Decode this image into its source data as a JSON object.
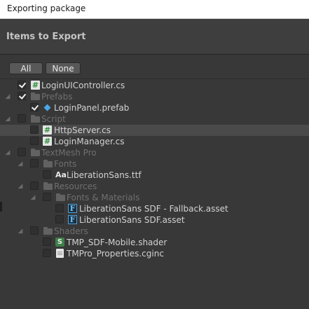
{
  "window": {
    "title": "Exporting package"
  },
  "header": {
    "title": "Items to Export"
  },
  "buttons": {
    "all": "All",
    "none": "None"
  },
  "tree": [
    {
      "label": "LoginUIController.cs",
      "icon": "csharp-script-icon",
      "checked": true
    },
    {
      "label": "Prefabs",
      "icon": "folder-icon",
      "checked": true,
      "dim": true
    },
    {
      "label": "LoginPanel.prefab",
      "icon": "prefab-cube-icon",
      "checked": true
    },
    {
      "label": "Script",
      "icon": "folder-icon",
      "checked": false,
      "dim": true
    },
    {
      "label": "HttpServer.cs",
      "icon": "csharp-script-icon",
      "checked": false,
      "selected": true
    },
    {
      "label": "LoginManager.cs",
      "icon": "csharp-script-icon",
      "checked": false
    },
    {
      "label": "TextMesh Pro",
      "icon": "folder-icon",
      "checked": false,
      "dim": true
    },
    {
      "label": "Fonts",
      "icon": "folder-icon",
      "checked": false,
      "dim": true
    },
    {
      "label": "LiberationSans.ttf",
      "icon": "font-file-icon",
      "icon_text": "Aa",
      "checked": false
    },
    {
      "label": "Resources",
      "icon": "folder-icon",
      "checked": false,
      "dim": true
    },
    {
      "label": "Fonts & Materials",
      "icon": "folder-icon",
      "checked": false,
      "dim": true
    },
    {
      "label": "LiberationSans SDF - Fallback.asset",
      "icon": "sdf-font-asset-icon",
      "icon_text": "F",
      "checked": false
    },
    {
      "label": "LiberationSans SDF.asset",
      "icon": "sdf-font-asset-icon",
      "icon_text": "F",
      "checked": false
    },
    {
      "label": "Shaders",
      "icon": "folder-icon",
      "checked": false,
      "dim": true
    },
    {
      "label": "TMP_SDF-Mobile.shader",
      "icon": "shader-icon",
      "icon_text": "S",
      "checked": false
    },
    {
      "label": "TMPro_Properties.cginc",
      "icon": "text-document-icon",
      "checked": false
    }
  ]
}
